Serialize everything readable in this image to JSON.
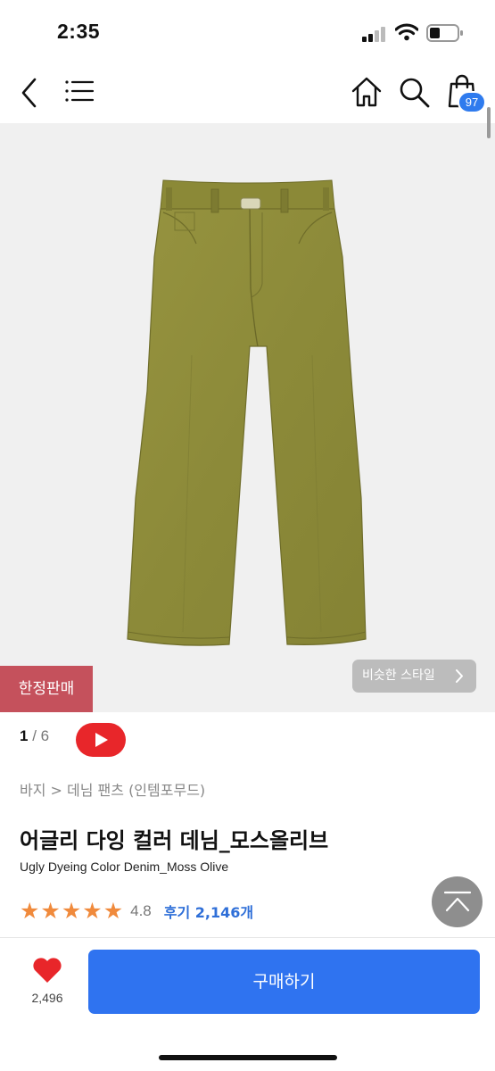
{
  "status_bar": {
    "time": "2:35"
  },
  "nav": {
    "icons": [
      "back-arrow-icon",
      "hamburger-menu-icon",
      "home-icon",
      "search-icon",
      "shopping-bag-icon"
    ],
    "cart_count": "97"
  },
  "gallery": {
    "badge": "한정판매",
    "similar_style": "비슷한 스타일",
    "current": "1",
    "separator": "/",
    "total": "6",
    "colors": {
      "background": "#f0f0f0",
      "product": "#8f8c3b",
      "badge": "#c5515c",
      "video": "#e8262a"
    }
  },
  "product": {
    "breadcrumb": "바지 > 데님 팬츠 (인템포무드)",
    "title_ko": "어글리 다잉 컬러 데님_모스올리브",
    "title_en": "Ugly Dyeing Color Denim_Moss Olive",
    "rating": "4.8",
    "rating_fraction": 0.96,
    "review_link": "후기 2,146개"
  },
  "bottom": {
    "like_count": "2,496",
    "buy_label": "구매하기",
    "colors": {
      "accent": "#2f73f0",
      "heart": "#e8262a"
    }
  }
}
